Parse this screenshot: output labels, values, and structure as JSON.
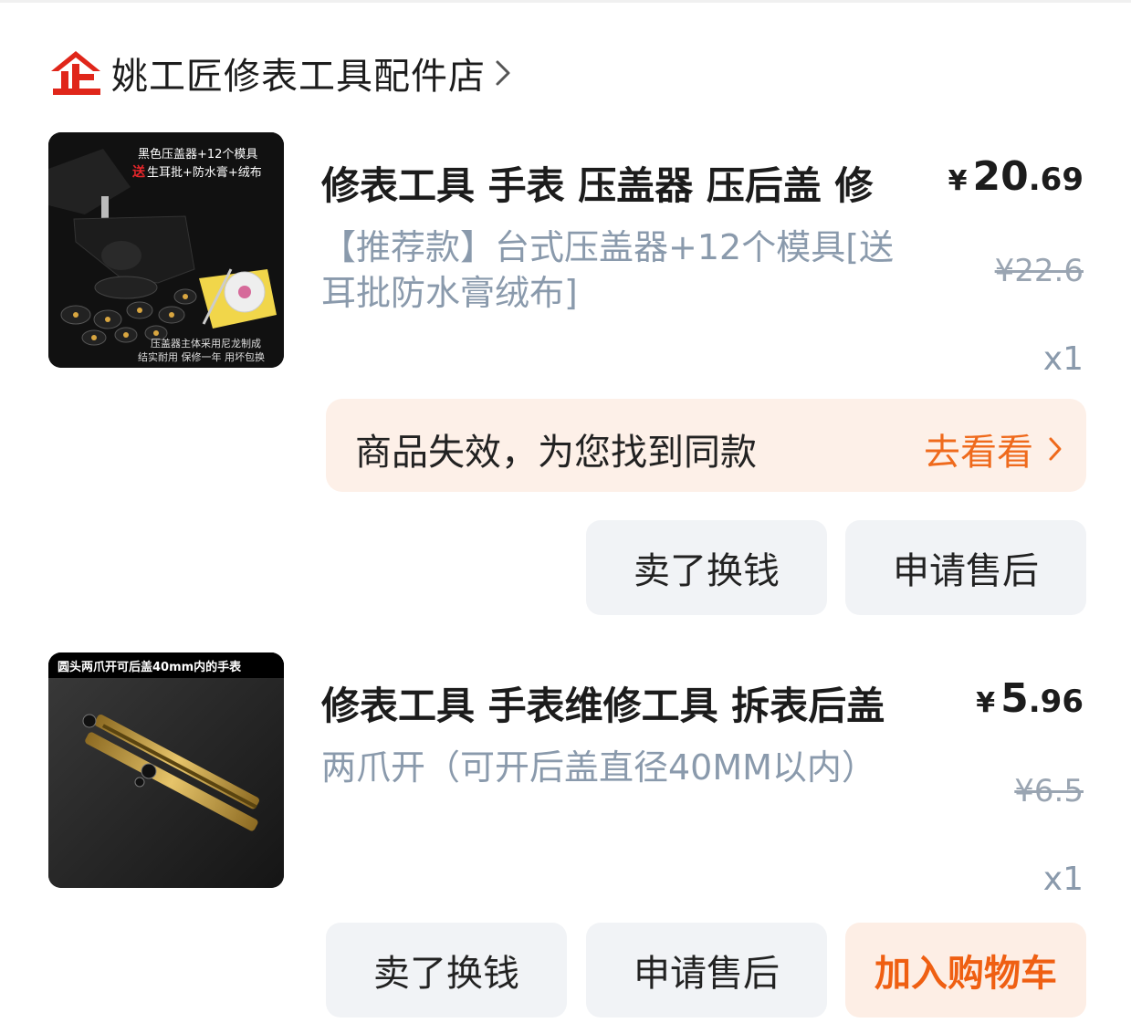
{
  "store": {
    "logo_icon": "enterprise-store-icon",
    "name": "姚工匠修表工具配件店",
    "chevron_icon": "chevron-right-icon"
  },
  "items": [
    {
      "image_texts": [
        "黑色压盖器+12个模具",
        "送",
        "生耳批+防水膏+绒布",
        "压盖器主体采用尼龙制成",
        "结实耐用  保修一年  用坏包换"
      ],
      "title": "修表工具 手表 压盖器 压后盖 修",
      "sku": "【推荐款】台式压盖器+12个模具[送耳批防水膏绒布]",
      "price_symbol": "¥",
      "price_int": "20",
      "price_dec": ".69",
      "original_price": "¥22.6",
      "quantity": "x1"
    },
    {
      "image_texts": [
        "圆头两爪开可后盖40mm内的手表"
      ],
      "title": "修表工具 手表维修工具 拆表后盖",
      "sku": "两爪开（可开后盖直径40MM以内）",
      "price_symbol": "¥",
      "price_int": "5",
      "price_dec": ".96",
      "original_price": "¥6.5",
      "quantity": "x1"
    }
  ],
  "notice": {
    "text": "商品失效，为您找到同款",
    "link_label": "去看看",
    "link_icon": "chevron-right-icon"
  },
  "item1_actions": {
    "sell": "卖了换钱",
    "after_sales": "申请售后"
  },
  "item2_actions": {
    "sell": "卖了换钱",
    "after_sales": "申请售后",
    "add_cart": "加入购物车"
  },
  "colors": {
    "accent_orange": "#ef6a1c",
    "logo_red": "#e0261a",
    "notice_bg": "#fdf0e8",
    "button_bg": "#f1f3f6",
    "muted_text": "#8a9aac"
  }
}
